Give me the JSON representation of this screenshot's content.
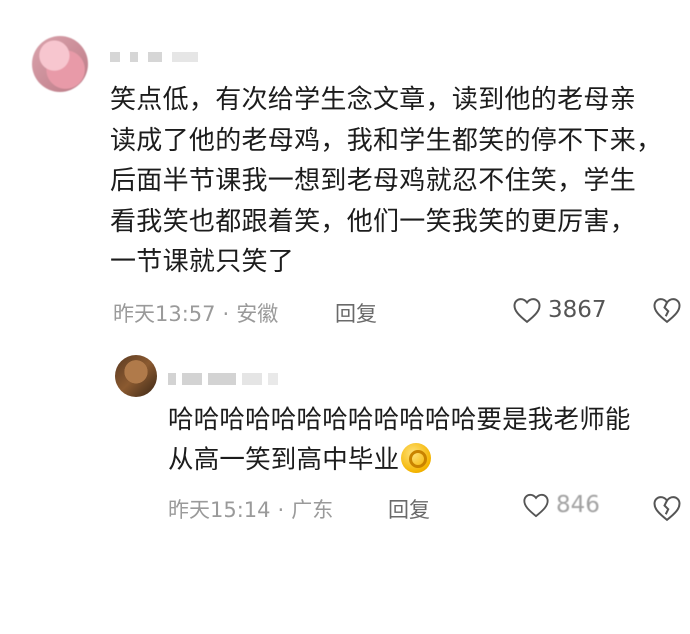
{
  "comment": {
    "text": "笑点低，有次给学生念文章，读到他的老母亲\n读成了他的老母鸡，我和学生都笑的停不下来，\n后面半节课我一想到老母鸡就忍不住笑，学生\n看我笑也都跟着笑，他们一笑我笑的更厉害，\n一节课就只笑了",
    "time": "昨天13:57",
    "location": "安徽",
    "reply_label": "回复",
    "likes": "3867",
    "separator": "·"
  },
  "reply": {
    "text": "哈哈哈哈哈哈哈哈哈哈哈哈要是我老师能\n从高一笑到高中毕业",
    "emoji_icon": "ok-hand-emoji",
    "time": "昨天15:14",
    "location": "广东",
    "reply_label": "回复",
    "likes": "846",
    "separator": "·"
  }
}
